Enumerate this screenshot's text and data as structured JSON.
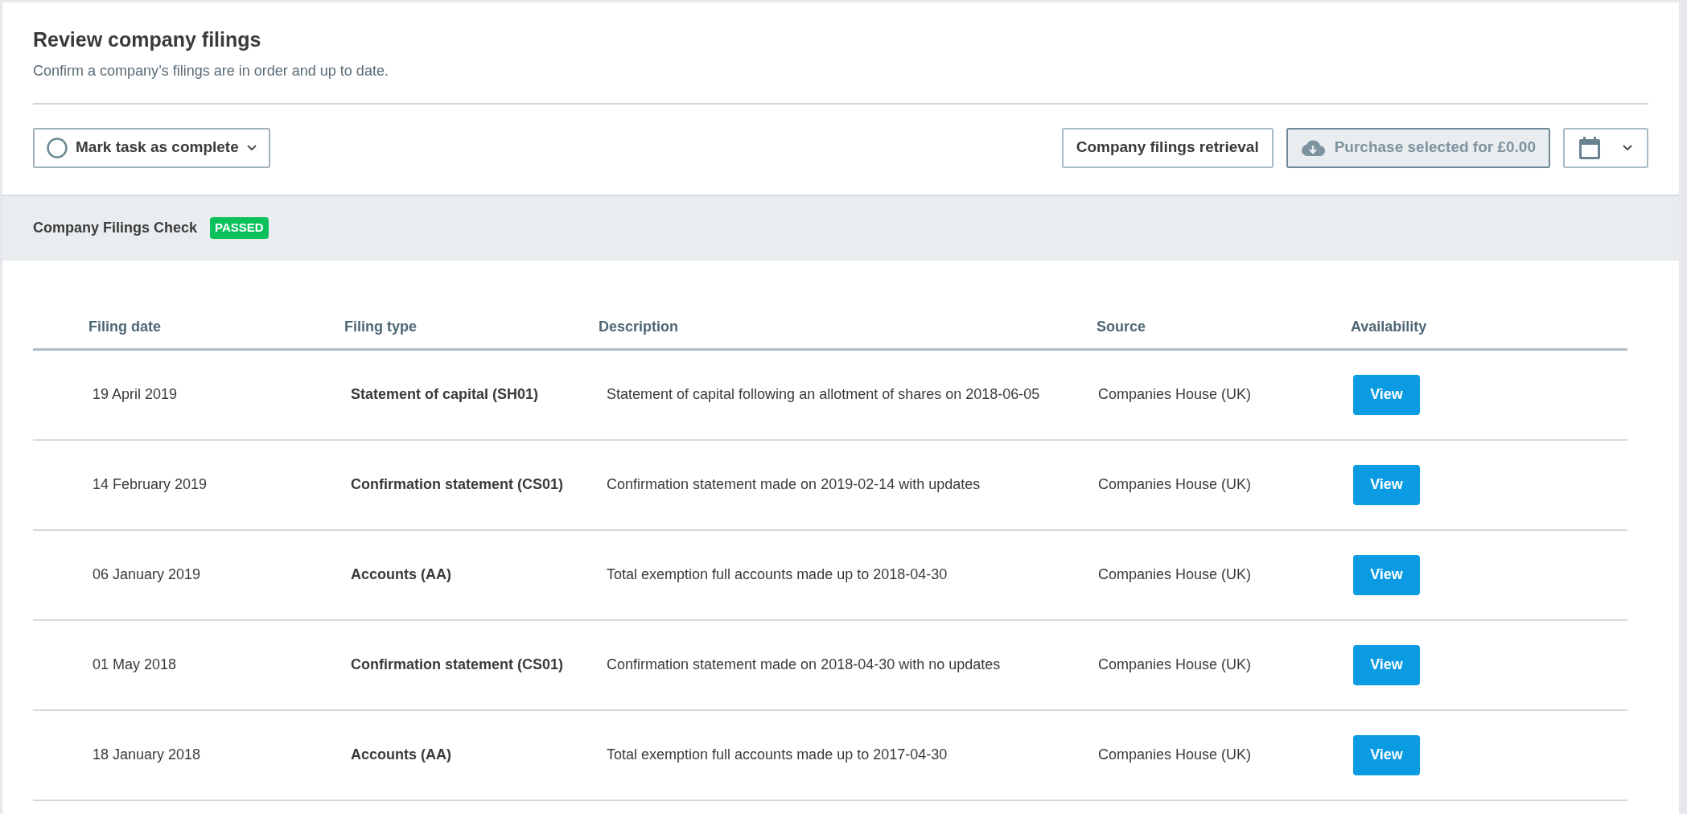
{
  "header": {
    "title": "Review company filings",
    "subtitle": "Confirm a company’s filings are in order and up to date."
  },
  "toolbar": {
    "mark_complete": {
      "label": "Mark task as complete",
      "checked": false
    },
    "retrieval_button": "Company filings retrieval",
    "purchase_button": {
      "label": "Purchase selected for £0.00",
      "disabled": true
    }
  },
  "check": {
    "title": "Company Filings Check",
    "status": "PASSED",
    "color": "#0bc15c"
  },
  "table": {
    "columns": [
      "Filing date",
      "Filing type",
      "Description",
      "Source",
      "Availability"
    ],
    "rows": [
      {
        "date": "19 April 2019",
        "type": "Statement of capital (SH01)",
        "description": "Statement of capital following an allotment of shares on 2018-06-05",
        "source": "Companies House (UK)",
        "action": "View"
      },
      {
        "date": "14 February 2019",
        "type": "Confirmation statement (CS01)",
        "description": "Confirmation statement made on 2019-02-14 with updates",
        "source": "Companies House (UK)",
        "action": "View"
      },
      {
        "date": "06 January 2019",
        "type": "Accounts (AA)",
        "description": "Total exemption full accounts made up to 2018-04-30",
        "source": "Companies House (UK)",
        "action": "View"
      },
      {
        "date": "01 May 2018",
        "type": "Confirmation statement (CS01)",
        "description": "Confirmation statement made on 2018-04-30 with no updates",
        "source": "Companies House (UK)",
        "action": "View"
      },
      {
        "date": "18 January 2018",
        "type": "Accounts (AA)",
        "description": "Total exemption full accounts made up to 2017-04-30",
        "source": "Companies House (UK)",
        "action": "View"
      }
    ]
  }
}
